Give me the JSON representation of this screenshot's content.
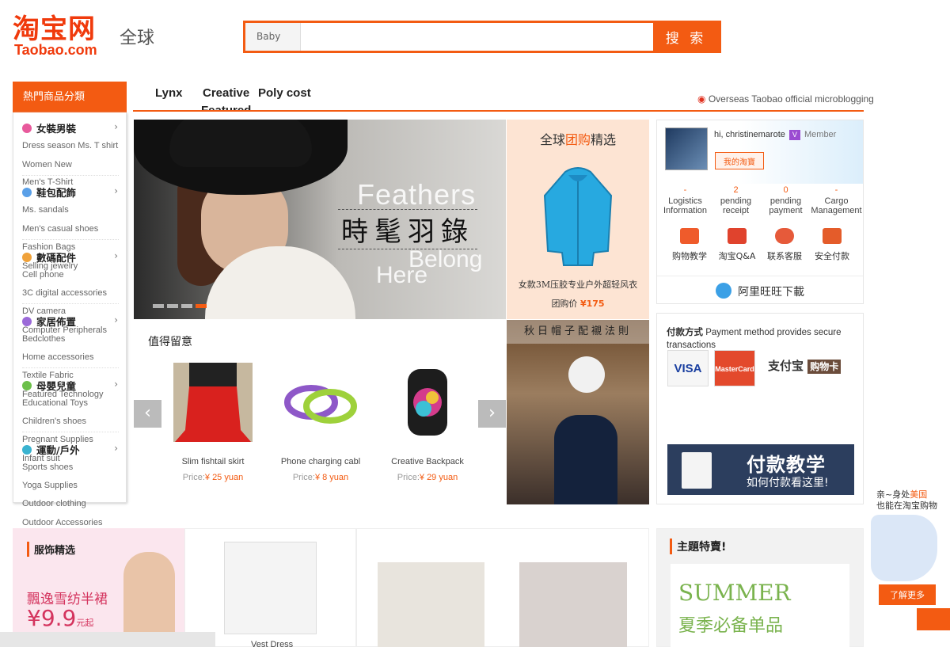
{
  "header": {
    "logo_cn": "淘宝网",
    "logo_en": "Taobao.com",
    "global": "全球",
    "search_category": "Baby",
    "search_value": "",
    "search_button": "搜 索"
  },
  "sidebar": {
    "header": "熱門商品分類",
    "groups": [
      {
        "title": "女裝男裝",
        "links": [
          "Dress season Ms. T shirt",
          "Women New",
          "Men's T-Shirt"
        ]
      },
      {
        "title": "鞋包配飾",
        "links": [
          "Ms. sandals",
          "Men's casual shoes",
          "Fashion Bags"
        ]
      },
      {
        "title": "數碼配件",
        "links": [
          "Selling jewelry",
          "Cell phone",
          "3C digital accessories",
          "DV camera"
        ]
      },
      {
        "title": "家居佈置",
        "links": [
          "Computer Peripherals",
          "Bedclothes",
          "Home accessories",
          "Textile Fabric"
        ]
      },
      {
        "title": "母嬰兒童",
        "links": [
          "Featured Technology",
          "Educational Toys",
          "Children's shoes",
          "Pregnant Supplies"
        ]
      },
      {
        "title": "運動/戶外",
        "links": [
          "Infant suit",
          "Sports shoes",
          "Yoga Supplies",
          "Outdoor clothing",
          "Outdoor Accessories"
        ]
      }
    ]
  },
  "nav": {
    "items": [
      "Lynx",
      "Creative",
      "Poly cost",
      "Featured"
    ],
    "weibo": "Overseas Taobao official microblogging"
  },
  "banner": {
    "en_top": "Feathers",
    "cn": "時髦羽錄",
    "en_mid": "Belong",
    "en_bottom": "Here",
    "active_slide": 4
  },
  "group_buy": {
    "title_a": "全球",
    "title_b": "团购",
    "title_c": "精选",
    "product": "女款3M压胶专业户外超轻风衣",
    "price_label": "团购价",
    "price": "¥175"
  },
  "account": {
    "greeting": "hi, christinemarote",
    "vip": "V",
    "member": "Member",
    "my_taobao": "我的淘寶",
    "stats": [
      {
        "value": "-",
        "label": "Logistics Information"
      },
      {
        "value": "2",
        "label": "pending receipt"
      },
      {
        "value": "0",
        "label": "pending payment"
      },
      {
        "value": "-",
        "label": "Cargo Management"
      }
    ],
    "services": [
      "购物教学",
      "淘宝Q&A",
      "联系客服",
      "安全付款"
    ],
    "wangwang": "阿里旺旺下載"
  },
  "payment": {
    "title": "付款方式",
    "text": "Payment method provides secure transactions",
    "cards": [
      "VISA",
      "MasterCard"
    ],
    "alipay": "支付宝",
    "purchase_card": "购物卡",
    "banner_title": "付款教学",
    "banner_sub": "如何付款看这里!"
  },
  "worth": {
    "title": "值得留意",
    "products": [
      {
        "name": "Slim fishtail skirt",
        "price_label": "Price:",
        "price": "¥ 25 yuan"
      },
      {
        "name": "Phone charging cabl",
        "price_label": "Price:",
        "price": "¥ 8 yuan"
      },
      {
        "name": "Creative Backpack",
        "price_label": "Price:",
        "price": "¥ 29 yuan"
      }
    ]
  },
  "autumn": {
    "title": "秋日帽子配襯法則"
  },
  "bottom": {
    "clothing_title": "服饰精选",
    "skirt_cn": "飄逸雪纺半裙",
    "skirt_price": "¥9.9",
    "skirt_unit": "元起",
    "vest_label": "Vest Dress",
    "theme_title": "主題特賣!",
    "summer_en": "SUMMER",
    "summer_cn": "夏季必备单品"
  },
  "float": {
    "line1_a": "亲~身处",
    "line1_b": "美国",
    "line2": "也能在淘宝购物",
    "more": "了解更多"
  },
  "colors": {
    "accent": "#f35b12"
  }
}
